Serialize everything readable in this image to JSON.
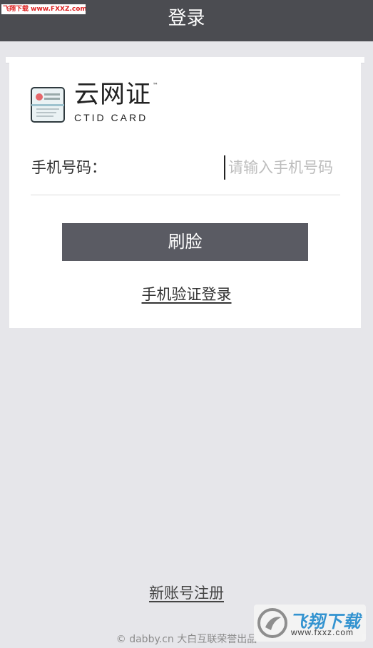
{
  "header": {
    "title": "登录"
  },
  "watermark_top": {
    "text": "飞翔下载 www.FXXZ.com"
  },
  "logo": {
    "name": "云网证",
    "tm": "™",
    "subtitle": "CTID CARD"
  },
  "phone": {
    "label": "手机号码：",
    "placeholder": "请输入手机号码",
    "value": ""
  },
  "actions": {
    "face_login": "刷脸",
    "sms_login": "手机验证登录",
    "register": "新账号注册"
  },
  "footer": {
    "text": "© dabby.cn 大白互联荣誉出品"
  },
  "watermark_br": {
    "main": "飞翔下载",
    "sub": "www.fxxz.com"
  },
  "colors": {
    "header_bg": "#4b4c51",
    "button_bg": "#5a5b63",
    "page_bg": "#e6e6ea"
  }
}
